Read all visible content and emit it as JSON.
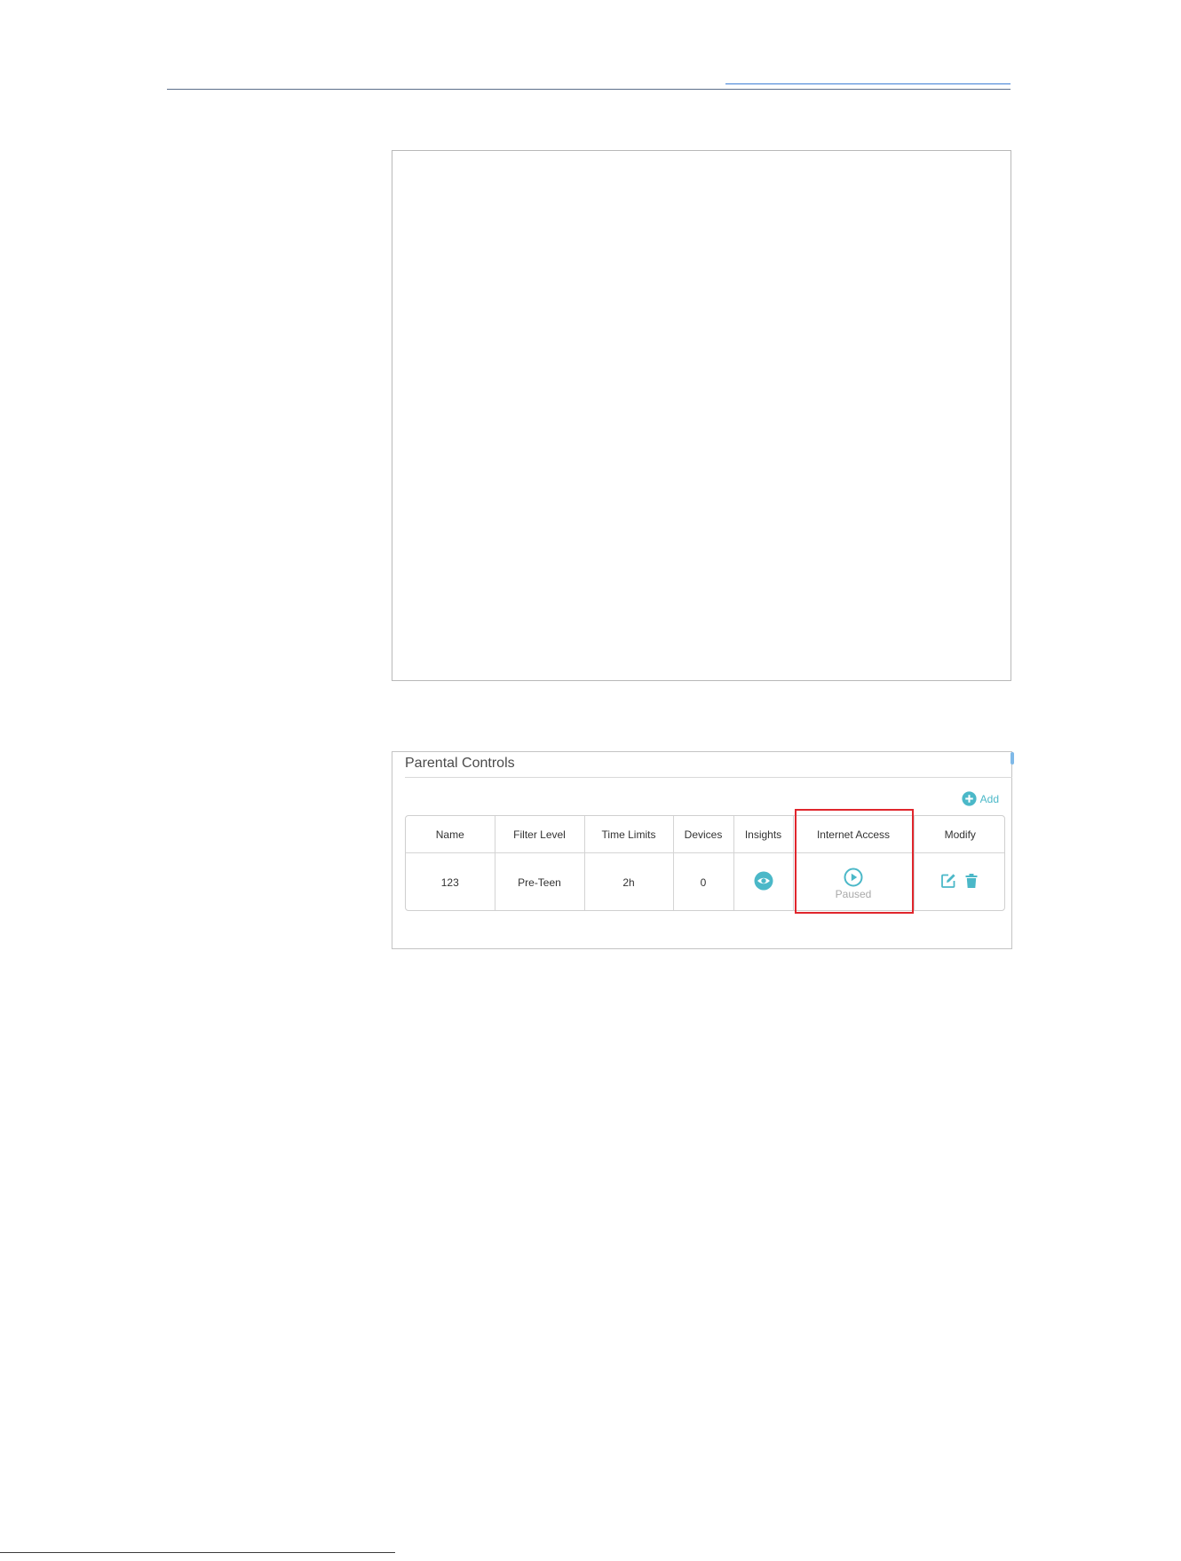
{
  "panel": {
    "title": "Parental Controls",
    "add_label": "Add"
  },
  "table": {
    "headers": {
      "name": "Name",
      "filter_level": "Filter Level",
      "time_limits": "Time Limits",
      "devices": "Devices",
      "insights": "Insights",
      "internet_access": "Internet Access",
      "modify": "Modify"
    },
    "rows": [
      {
        "name": "123",
        "filter_level": "Pre-Teen",
        "time_limits": "2h",
        "devices": "0",
        "internet_access_status": "Paused"
      }
    ]
  },
  "colors": {
    "accent": "#4bb8c8",
    "highlight": "#e0262d",
    "muted_text": "#a9a9a9"
  },
  "icons": {
    "add": "plus-circle-icon",
    "insights": "eye-icon",
    "internet_access": "play-circle-icon",
    "edit": "edit-icon",
    "delete": "trash-icon"
  }
}
